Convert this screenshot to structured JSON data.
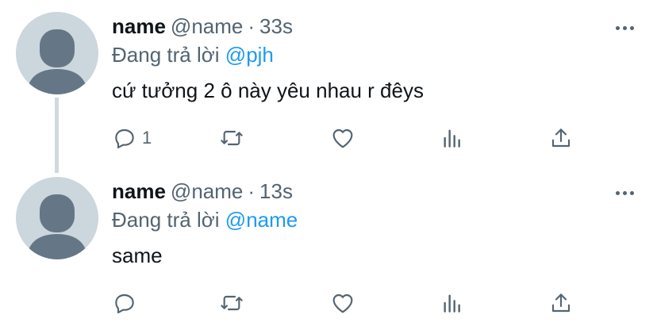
{
  "tweets": [
    {
      "display_name": "name",
      "handle": "@name",
      "dot": "·",
      "time": "33s",
      "reply_prefix": "Đang trả lời",
      "reply_to": "@pjh",
      "text": "cứ tưởng 2 ô này yêu nhau r đêys",
      "reply_count": "1",
      "icons": [
        "comment-icon",
        "retweet-icon",
        "heart-icon",
        "analytics-icon",
        "share-icon",
        "more-icon"
      ]
    },
    {
      "display_name": "name",
      "handle": "@name",
      "dot": "·",
      "time": "13s",
      "reply_prefix": "Đang trả lời",
      "reply_to": "@name",
      "text": "same",
      "reply_count": "",
      "icons": [
        "comment-icon",
        "retweet-icon",
        "heart-icon",
        "analytics-icon",
        "share-icon",
        "more-icon"
      ]
    }
  ],
  "colors": {
    "text": "#0f1419",
    "secondary": "#536471",
    "mention": "#1d9bf0",
    "avatar_bg": "#ccd6dd",
    "avatar_fg": "#657786",
    "thread_line": "#cfd9de"
  }
}
